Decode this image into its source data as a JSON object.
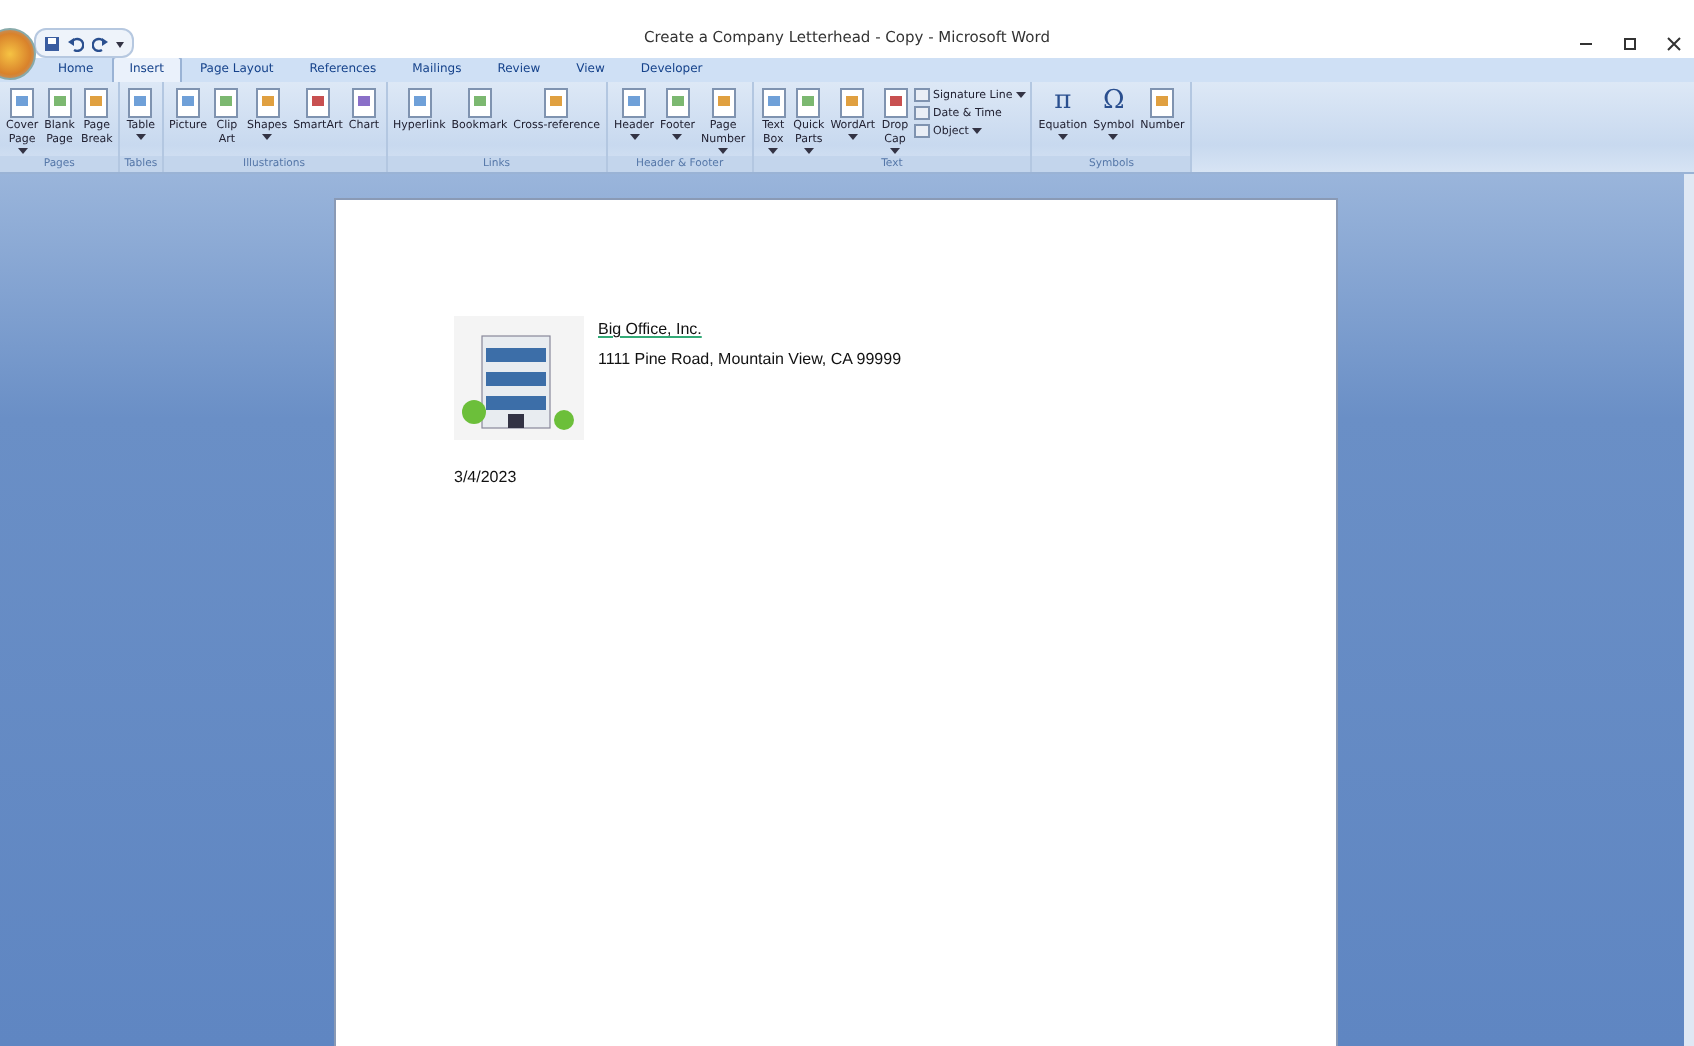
{
  "window": {
    "title": "Create a Company Letterhead - Copy - Microsoft Word"
  },
  "tabs": [
    {
      "label": "Home",
      "selected": false
    },
    {
      "label": "Insert",
      "selected": true
    },
    {
      "label": "Page Layout",
      "selected": false
    },
    {
      "label": "References",
      "selected": false
    },
    {
      "label": "Mailings",
      "selected": false
    },
    {
      "label": "Review",
      "selected": false
    },
    {
      "label": "View",
      "selected": false
    },
    {
      "label": "Developer",
      "selected": false
    }
  ],
  "ribbon_groups": [
    {
      "label": "Pages",
      "items": [
        {
          "kind": "large",
          "lines": [
            "Cover",
            "Page"
          ],
          "dropdown": true
        },
        {
          "kind": "large",
          "lines": [
            "Blank",
            "Page"
          ],
          "dropdown": false
        },
        {
          "kind": "large",
          "lines": [
            "Page",
            "Break"
          ],
          "dropdown": false
        }
      ]
    },
    {
      "label": "Tables",
      "items": [
        {
          "kind": "large",
          "lines": [
            "Table"
          ],
          "dropdown": true
        }
      ]
    },
    {
      "label": "Illustrations",
      "items": [
        {
          "kind": "large",
          "lines": [
            "Picture"
          ],
          "dropdown": false
        },
        {
          "kind": "large",
          "lines": [
            "Clip",
            "Art"
          ],
          "dropdown": false
        },
        {
          "kind": "large",
          "lines": [
            "Shapes"
          ],
          "dropdown": true
        },
        {
          "kind": "large",
          "lines": [
            "SmartArt"
          ],
          "dropdown": false
        },
        {
          "kind": "large",
          "lines": [
            "Chart"
          ],
          "dropdown": false
        }
      ]
    },
    {
      "label": "Links",
      "items": [
        {
          "kind": "large",
          "lines": [
            "Hyperlink"
          ],
          "dropdown": false
        },
        {
          "kind": "large",
          "lines": [
            "Bookmark"
          ],
          "dropdown": false
        },
        {
          "kind": "large",
          "lines": [
            "Cross-reference"
          ],
          "dropdown": false
        }
      ]
    },
    {
      "label": "Header & Footer",
      "items": [
        {
          "kind": "large",
          "lines": [
            "Header"
          ],
          "dropdown": true
        },
        {
          "kind": "large",
          "lines": [
            "Footer"
          ],
          "dropdown": true
        },
        {
          "kind": "large",
          "lines": [
            "Page",
            "Number"
          ],
          "dropdown": true
        }
      ]
    },
    {
      "label": "Text",
      "items": [
        {
          "kind": "large",
          "lines": [
            "Text",
            "Box"
          ],
          "dropdown": true
        },
        {
          "kind": "large",
          "lines": [
            "Quick",
            "Parts"
          ],
          "dropdown": true
        },
        {
          "kind": "large",
          "lines": [
            "WordArt"
          ],
          "dropdown": true
        },
        {
          "kind": "large",
          "lines": [
            "Drop",
            "Cap"
          ],
          "dropdown": true
        },
        {
          "kind": "small",
          "lines": [
            "Signature Line"
          ],
          "dropdown": true
        },
        {
          "kind": "small",
          "lines": [
            "Date & Time"
          ],
          "dropdown": false
        },
        {
          "kind": "small",
          "lines": [
            "Object"
          ],
          "dropdown": true
        }
      ]
    },
    {
      "label": "Symbols",
      "items": [
        {
          "kind": "large",
          "lines": [
            "Equation"
          ],
          "dropdown": true,
          "glyph": "π"
        },
        {
          "kind": "large",
          "lines": [
            "Symbol"
          ],
          "dropdown": true,
          "glyph": "Ω"
        },
        {
          "kind": "large",
          "lines": [
            "Number"
          ],
          "dropdown": false
        }
      ]
    }
  ],
  "document": {
    "company": "Big Office, Inc.",
    "address": "1111 Pine Road, Mountain View, CA 99999",
    "date": "3/4/2023"
  }
}
